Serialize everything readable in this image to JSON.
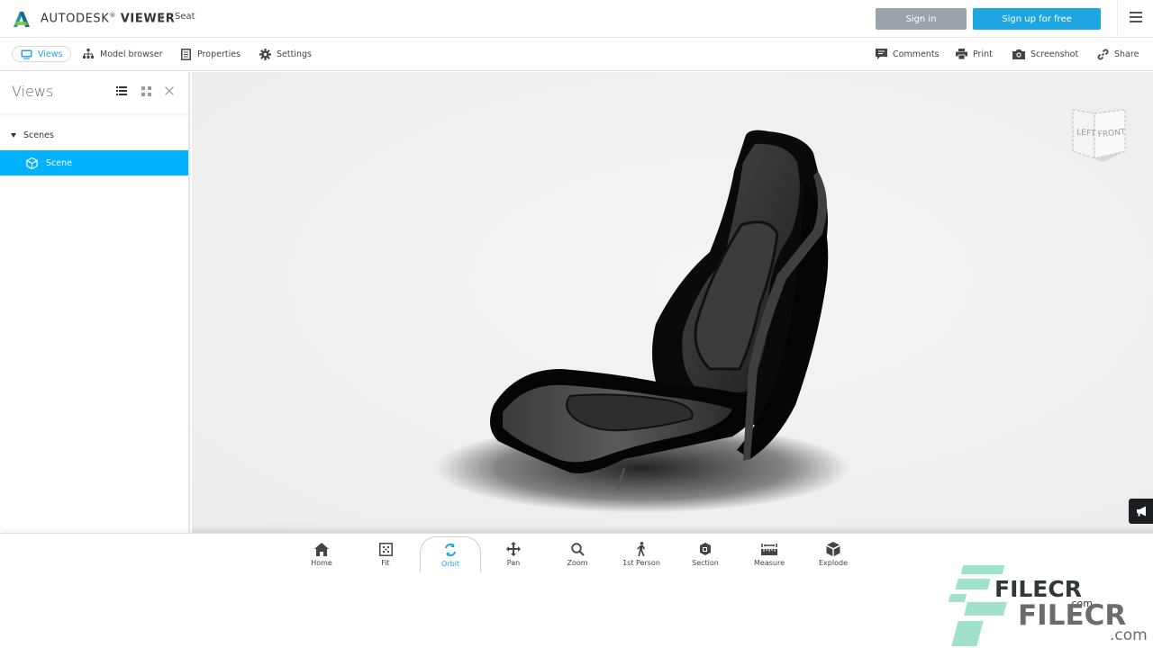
{
  "header": {
    "brand_regular": "AUTODESK",
    "brand_bold": "VIEWER",
    "breadcrumb_sep": "›",
    "breadcrumb_item": "Seat",
    "sign_in_label": "Sign in",
    "sign_up_label": "Sign up for free",
    "menu_icon": "hamburger-icon",
    "colors": {
      "primary": "#1ea6e3",
      "secondary": "#9ba3aa"
    }
  },
  "toolbar": {
    "left": [
      {
        "label": "Views",
        "icon": "monitor-icon",
        "active": true
      },
      {
        "label": "Model browser",
        "icon": "hierarchy-icon",
        "active": false
      },
      {
        "label": "Properties",
        "icon": "document-icon",
        "active": false
      },
      {
        "label": "Settings",
        "icon": "gear-icon",
        "active": false
      }
    ],
    "right": [
      {
        "label": "Comments",
        "icon": "comment-icon"
      },
      {
        "label": "Print",
        "icon": "printer-icon"
      },
      {
        "label": "Screenshot",
        "icon": "camera-icon"
      },
      {
        "label": "Share",
        "icon": "link-icon"
      }
    ]
  },
  "panel": {
    "title": "Views",
    "controls": [
      "list-view-icon",
      "grid-view-icon",
      "close-icon"
    ],
    "tree": {
      "group_label": "Scenes",
      "items": [
        {
          "label": "Scene",
          "icon": "cube-icon",
          "selected": true
        }
      ]
    },
    "selection_color": "#00b2ff"
  },
  "viewer": {
    "model_name": "Seat",
    "viewcube": {
      "left_face": "LEFT",
      "front_face": "FRONT"
    },
    "feedback_icon": "megaphone-icon"
  },
  "navbar": {
    "tools": [
      {
        "label": "Home",
        "icon": "home-icon",
        "active": false
      },
      {
        "label": "Fit",
        "icon": "fit-icon",
        "active": false
      },
      {
        "label": "Orbit",
        "icon": "orbit-icon",
        "active": true
      },
      {
        "label": "Pan",
        "icon": "pan-icon",
        "active": false
      },
      {
        "label": "Zoom",
        "icon": "zoom-icon",
        "active": false
      },
      {
        "label": "1st Person",
        "icon": "walk-icon",
        "active": false
      },
      {
        "label": "Section",
        "icon": "section-icon",
        "active": false
      },
      {
        "label": "Measure",
        "icon": "measure-icon",
        "active": false
      },
      {
        "label": "Explode",
        "icon": "explode-icon",
        "active": false
      }
    ]
  },
  "watermark": {
    "line1": "FILECR",
    "line1_suffix": ".com",
    "line2": "FILECR",
    "line2_suffix": ".com"
  }
}
